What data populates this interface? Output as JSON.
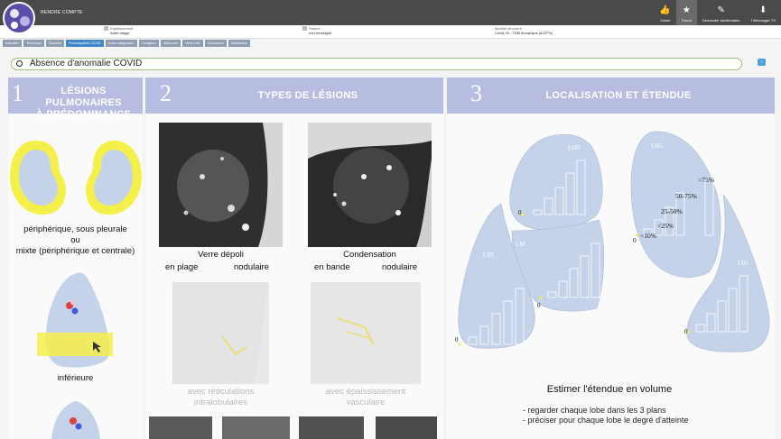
{
  "header": {
    "account_label": "RENDRE COMPTE",
    "actions": [
      {
        "icon": "thumb-up-icon",
        "label": "J'aime",
        "glyph": "👍"
      },
      {
        "icon": "star-icon",
        "label": "Favori",
        "glyph": "★"
      },
      {
        "icon": "feedback-icon",
        "label": "Demander amélioration",
        "glyph": "✎"
      },
      {
        "icon": "cloud-download-icon",
        "label": "Télécharger TS",
        "glyph": "⬇"
      }
    ]
  },
  "infobar": {
    "establishment_label": "Etablissement",
    "establishment_value": "Autre usage",
    "patient_label": "Patient",
    "patient_value": "non renseigné",
    "model_label": "Modèle structuré",
    "model_value": "Covid 19 - TDM thoracique (4227%)"
  },
  "tabs": [
    "Indication",
    "Technique",
    "Scénario",
    "Pneumopathie COVID",
    "Autres diagnostics",
    "Ganglions",
    "Abdo-pelv",
    "Ventr.Vrac",
    "Conclusion",
    "Satisfaction"
  ],
  "active_tab_index": 3,
  "status": {
    "text": "Absence d'anomalie COVID",
    "help_label": "?"
  },
  "panel1": {
    "number": "1",
    "title_line1": "LÉSIONS PULMONAIRES",
    "title_line2": "À PRÉDOMINANCE",
    "caption1_line1": "périphérique, sous pleurale",
    "caption1_line2": "ou",
    "caption1_line3": "mixte (périphérique et centrale)",
    "caption2": "inférieure"
  },
  "panel2": {
    "number": "2",
    "title": "TYPES DE LÉSIONS",
    "img1_title": "Verre dépoli",
    "img1_sub_left": "en plage",
    "img1_sub_right": "nodulaire",
    "img2_title": "Condensation",
    "img2_sub_left": "en bande",
    "img2_sub_right": "nodulaire",
    "img3_caption_line1": "avec réticulations",
    "img3_caption_line2": "intralobulaires",
    "img4_caption_line1": "avec épaississement",
    "img4_caption_line2": "vasculaire"
  },
  "panel3": {
    "number": "3",
    "title": "LOCALISATION ET ÉTENDUE",
    "lobes": [
      "LSD",
      "LSG",
      "LM",
      "LID",
      "LIG"
    ],
    "extent_levels": [
      "0",
      "<10%",
      "<25%",
      "25-50%",
      "50-75%",
      ">75%"
    ],
    "zero_label": "0",
    "estimate_title": "Estimer l'étendue en volume",
    "bullet1": "- regarder chaque lobe dans les 3 plans",
    "bullet2": "- préciser pour chaque lobe le degré d'atteinte"
  },
  "colors": {
    "panel_header": "#b7bde0",
    "lung_fill": "#c5d3ea",
    "highlight_yellow": "#f5ef4a",
    "status_border": "#9fbf7e",
    "active_tab": "#3f86c8"
  }
}
